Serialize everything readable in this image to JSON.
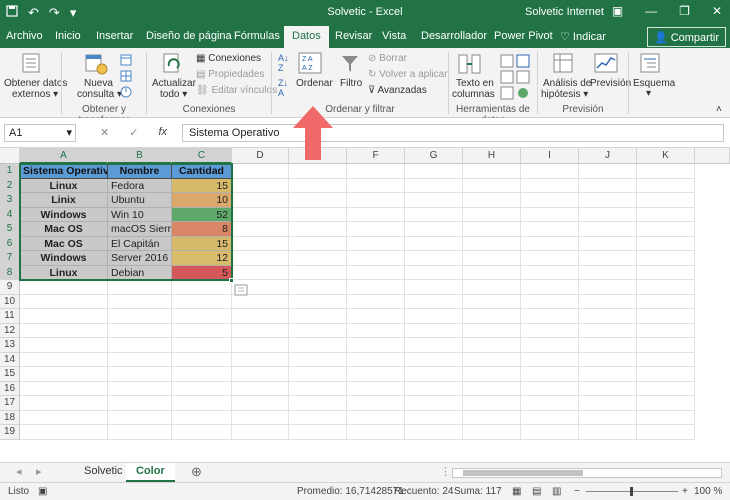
{
  "titlebar": {
    "title": "Solvetic  -  Excel",
    "user": "Solvetic Internet",
    "undo": "↶",
    "redo": "↷",
    "minimize": "—",
    "restore": "❐",
    "close": "✕"
  },
  "tabs": [
    {
      "label": "Archivo"
    },
    {
      "label": "Inicio"
    },
    {
      "label": "Insertar"
    },
    {
      "label": "Diseño de página"
    },
    {
      "label": "Fórmulas"
    },
    {
      "label": "Datos"
    },
    {
      "label": "Revisar"
    },
    {
      "label": "Vista"
    },
    {
      "label": "Desarrollador"
    },
    {
      "label": "Power Pivot"
    },
    {
      "label": "Indicar"
    }
  ],
  "share": "Compartir",
  "ribbon": {
    "obtener": "Obtener datos",
    "externos": "externos ▾",
    "nueva": "Nueva",
    "consulta": "consulta ▾",
    "group1": "Obtener y transformar",
    "actualizar": "Actualizar",
    "todo": "todo ▾",
    "conexiones": "Conexiones",
    "propiedades": "Propiedades",
    "editar": "Editar vínculos",
    "group2": "Conexiones",
    "ordenar": "Ordenar",
    "filtro": "Filtro",
    "borrar": "Borrar",
    "volver": "Volver a aplicar",
    "avanzadas": "Avanzadas",
    "group3": "Ordenar y filtrar",
    "texto": "Texto en",
    "columnas": "columnas",
    "group4": "Herramientas de datos",
    "analisis": "Análisis de",
    "hipotesis": "hipótesis ▾",
    "prevision": "Previsión",
    "group5": "Previsión",
    "esquema": "Esquema"
  },
  "formula": {
    "name_box": "A1",
    "cancel": "✕",
    "enter": "✓",
    "fx": "fx",
    "content": "Sistema Operativo"
  },
  "columns": [
    "A",
    "B",
    "C",
    "D",
    "E",
    "F",
    "G",
    "H",
    "I",
    "J",
    "K"
  ],
  "rows": [
    "1",
    "2",
    "3",
    "4",
    "5",
    "6",
    "7",
    "8",
    "9",
    "10",
    "11",
    "12",
    "13",
    "14",
    "15",
    "16",
    "17",
    "18",
    "19"
  ],
  "table": {
    "headers": [
      "Sistema Operativo",
      "Nombre",
      "Cantidad"
    ],
    "rows": [
      {
        "os": "Linux",
        "name": "Fedora",
        "qty": "15"
      },
      {
        "os": "Linix",
        "name": "Ubuntu",
        "qty": "10"
      },
      {
        "os": "Windows",
        "name": "Win 10",
        "qty": "52"
      },
      {
        "os": "Mac OS",
        "name": "macOS Sierra",
        "qty": "8"
      },
      {
        "os": "Mac OS",
        "name": "El Capitán",
        "qty": "15"
      },
      {
        "os": "Windows",
        "name": "Server 2016",
        "qty": "12"
      },
      {
        "os": "Linux",
        "name": "Debian",
        "qty": "5"
      }
    ],
    "qty_colors": [
      "#d7b96a",
      "#d9a86a",
      "#5ea86a",
      "#d98666",
      "#d7b96a",
      "#d8bb6b",
      "#d4575a"
    ]
  },
  "sheets": [
    {
      "label": "Solvetic"
    },
    {
      "label": "Color"
    }
  ],
  "add_sheet": "⊕",
  "status": {
    "ready": "Listo",
    "average": "Promedio: 16,71428571",
    "count": "Recuento: 24",
    "sum": "Suma: 117",
    "zoom": "100 %"
  },
  "colors": {
    "accent": "#217346",
    "header_fill": "#5b9bd5",
    "row_fill": "#c9c9c9",
    "arrow": "#f06a6a"
  }
}
